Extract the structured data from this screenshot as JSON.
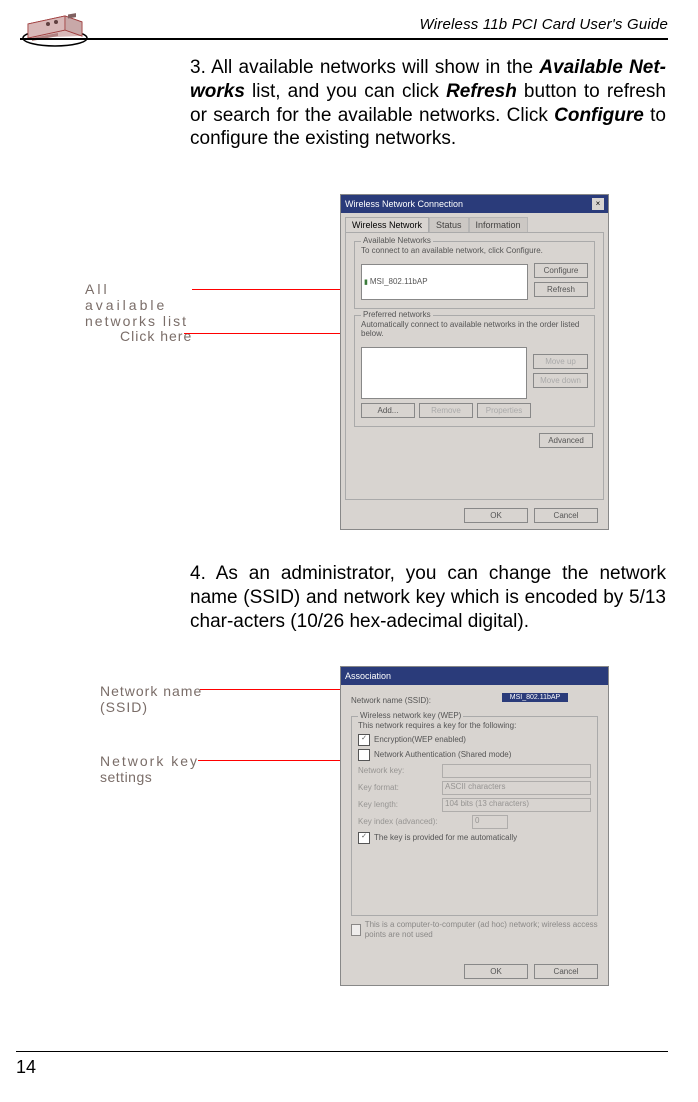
{
  "header": {
    "title": "Wireless 11b PCI Card User's Guide"
  },
  "page_number": "14",
  "steps": {
    "s3_pre": "3. All available networks will show in the ",
    "s3_b1": "Available Net-works",
    "s3_mid1": " list, and you can click ",
    "s3_b2": "Refresh",
    "s3_mid2": " button to refresh or search for the available networks. Click ",
    "s3_b3": "Configure",
    "s3_post": " to configure the existing networks.",
    "s4": "4. As an administrator, you can change the network name (SSID) and network key which is encoded by 5/13 char-acters (10/26 hex-adecimal digital)."
  },
  "callouts": {
    "c1a": "All available",
    "c1b": "networks list",
    "c2": "Click here",
    "c3a": "Network name",
    "c3b": "(SSID)",
    "c4a": "Network key",
    "c4b": "settings"
  },
  "ss1": {
    "title": "Wireless Network Connection",
    "tab1": "Wireless Network",
    "tab2": "Status",
    "tab3": "Information",
    "grp1": "Available Networks",
    "grp1_txt": "To connect to an available network, click Configure.",
    "netitem": "MSI_802.11bAP",
    "grp2": "Preferred networks",
    "grp2_txt": "Automatically connect to available networks in the order listed below.",
    "btn_configure": "Configure",
    "btn_refresh": "Refresh",
    "btn_moveup": "Move up",
    "btn_movedown": "Move down",
    "btn_add": "Add...",
    "btn_remove": "Remove",
    "btn_props": "Properties",
    "btn_advanced": "Advanced",
    "btn_ok": "OK",
    "btn_cancel": "Cancel"
  },
  "ss2": {
    "title": "Association",
    "lbl_ssid": "Network name (SSID):",
    "ssid_val": "MSI_802.11bAP",
    "grp": "Wireless network key (WEP)",
    "grp_txt": "This network requires a key for the following:",
    "chk1": "Encryption(WEP enabled)",
    "chk2": "Network Authentication (Shared mode)",
    "f1": "Network key:",
    "f2": "Key format:",
    "f2v": "ASCII characters",
    "f3": "Key length:",
    "f3v": "104 bits (13 characters)",
    "f4": "Key index (advanced):",
    "f4v": "0",
    "chk3": "The key is provided for me automatically",
    "foot": "This is a computer-to-computer (ad hoc) network; wireless access points are not used",
    "btn_ok": "OK",
    "btn_cancel": "Cancel"
  }
}
